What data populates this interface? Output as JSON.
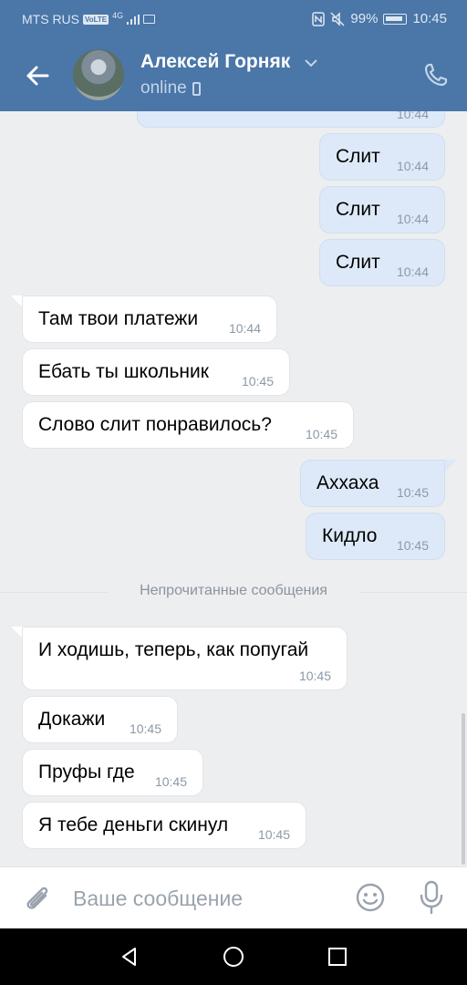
{
  "status_bar": {
    "carrier": "MTS RUS",
    "volte": "VoLTE",
    "network": "4G",
    "battery": "99%",
    "time": "10:45"
  },
  "header": {
    "contact_name": "Алексей Горняк",
    "status": "online"
  },
  "messages": [
    {
      "direction": "out",
      "text": "",
      "time": "10:44"
    },
    {
      "direction": "out",
      "text": "Слит",
      "time": "10:44"
    },
    {
      "direction": "out",
      "text": "Слит",
      "time": "10:44"
    },
    {
      "direction": "out",
      "text": "Слит",
      "time": "10:44"
    },
    {
      "direction": "in",
      "text": "Там твои платежи",
      "time": "10:44"
    },
    {
      "direction": "in",
      "text": "Ебать ты школьник",
      "time": "10:45"
    },
    {
      "direction": "in",
      "text": "Слово слит понравилось?",
      "time": "10:45"
    },
    {
      "direction": "out",
      "text": "Аххаха",
      "time": "10:45"
    },
    {
      "direction": "out",
      "text": "Кидло",
      "time": "10:45"
    },
    {
      "direction": "in",
      "text": "И ходишь, теперь, как попугай",
      "time": "10:45"
    },
    {
      "direction": "in",
      "text": "Докажи",
      "time": "10:45"
    },
    {
      "direction": "in",
      "text": "Пруфы где",
      "time": "10:45"
    },
    {
      "direction": "in",
      "text": "Я тебе деньги скинул",
      "time": "10:45"
    }
  ],
  "unread_divider": "Непрочитанные сообщения",
  "composer": {
    "placeholder": "Ваше сообщение"
  },
  "colors": {
    "header": "#4a76a8",
    "outgoing_bubble": "#dde9f8",
    "incoming_bubble": "#ffffff",
    "chat_background": "#edeef0"
  }
}
